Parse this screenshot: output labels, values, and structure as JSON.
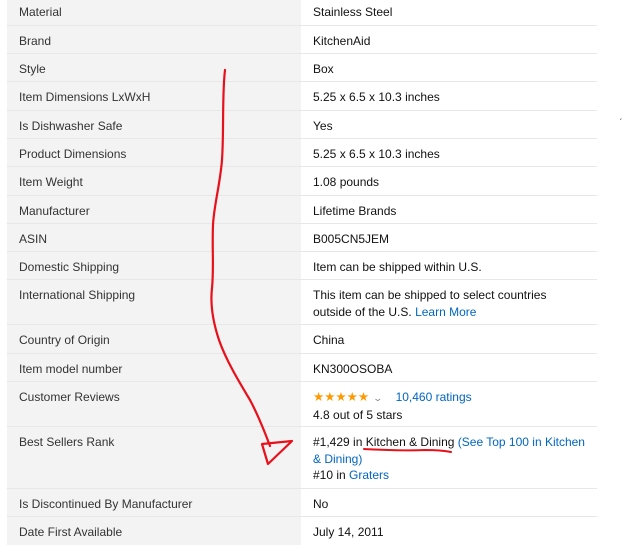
{
  "rows": [
    {
      "label": "Material",
      "value": "Stainless Steel"
    },
    {
      "label": "Brand",
      "value": "KitchenAid"
    },
    {
      "label": "Style",
      "value": "Box"
    },
    {
      "label": "Item Dimensions LxWxH",
      "value": "5.25 x 6.5 x 10.3 inches"
    },
    {
      "label": "Is Dishwasher Safe",
      "value": "Yes"
    },
    {
      "label": "Product Dimensions",
      "value": "5.25 x 6.5 x 10.3 inches"
    },
    {
      "label": "Item Weight",
      "value": "1.08 pounds"
    },
    {
      "label": "Manufacturer",
      "value": "Lifetime Brands"
    },
    {
      "label": "ASIN",
      "value": "B005CN5JEM"
    },
    {
      "label": "Domestic Shipping",
      "value": "Item can be shipped within U.S."
    },
    {
      "label": "International Shipping",
      "value": "This item can be shipped to select countries outside of the U.S.",
      "link": "Learn More"
    },
    {
      "label": "Country of Origin",
      "value": "China"
    },
    {
      "label": "Item model number",
      "value": "KN300OSOBA"
    }
  ],
  "reviews": {
    "label": "Customer Reviews",
    "stars": "★★★★★",
    "rating_value": 4.8,
    "ratings_link": "10,460 ratings",
    "rating_text": "4.8 out of 5 stars"
  },
  "best_sellers": {
    "label": "Best Sellers Rank",
    "rank1": "#1,429",
    "in1": " in ",
    "cat1": "Kitchen & Dining",
    "see_top": "(See Top 100 in Kitchen & Dining)",
    "rank2": "#10",
    "in2": " in ",
    "cat2": "Graters"
  },
  "bottom_rows": [
    {
      "label": "Is Discontinued By Manufacturer",
      "value": "No"
    },
    {
      "label": "Date First Available",
      "value": "July 14, 2011"
    }
  ],
  "colors": {
    "link": "#0066c0",
    "star": "#ff9900",
    "header_bg": "#f3f3f3",
    "annotation": "#e8101a"
  }
}
